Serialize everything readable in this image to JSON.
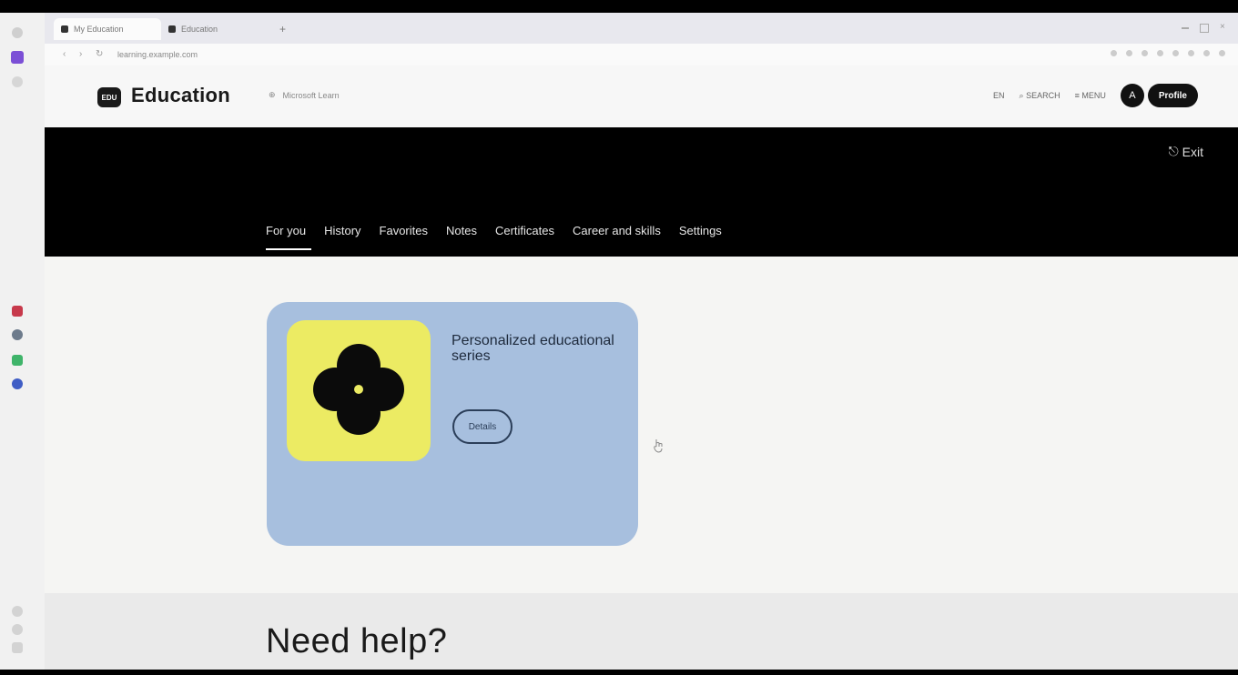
{
  "browser": {
    "tabs": [
      {
        "label": "My Education",
        "active": true
      },
      {
        "label": "Education",
        "active": false
      }
    ],
    "new_tab_label": "+",
    "url": "learning.example.com"
  },
  "header": {
    "logo_text": "EDU",
    "brand": "Education",
    "subtitle": "Microsoft Learn",
    "lang": "EN",
    "search_label": "SEARCH",
    "menu_label": "MENU",
    "avatar_initial": "A",
    "profile_label": "Profile"
  },
  "hero": {
    "exit_label": "Exit",
    "nav_tabs": [
      "For you",
      "History",
      "Favorites",
      "Notes",
      "Certificates",
      "Career and skills",
      "Settings"
    ]
  },
  "card": {
    "title": "Personalized educational series",
    "button_label": "Details"
  },
  "help": {
    "title": "Need help?"
  },
  "colors": {
    "card_bg": "#a7bfde",
    "thumb_bg": "#eceb63",
    "hero_bg": "#000000"
  }
}
